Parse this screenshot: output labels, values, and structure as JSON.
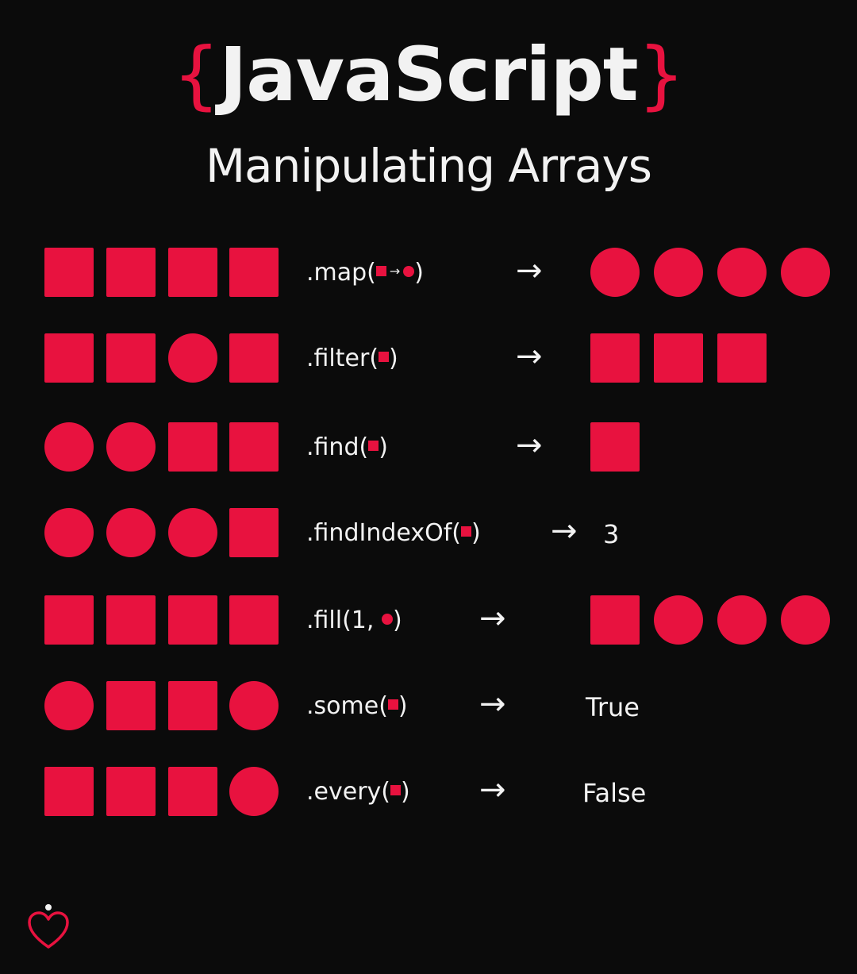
{
  "title": {
    "open_brace": "{",
    "text": "JavaScript",
    "close_brace": "}"
  },
  "subtitle": "Manipulating Arrays",
  "colors": {
    "accent": "#e8123f",
    "background": "#0b0b0b",
    "text": "#f2f2f2"
  },
  "arrow_glyph": "→",
  "rows": [
    {
      "input": [
        "square",
        "square",
        "square",
        "square"
      ],
      "method_parts": [
        ".map(",
        {
          "shape": "square"
        },
        {
          "arrow": "→"
        },
        {
          "shape": "circle"
        },
        ")"
      ],
      "result_shapes": [
        "circle",
        "circle",
        "circle",
        "circle"
      ]
    },
    {
      "input": [
        "square",
        "square",
        "circle",
        "square"
      ],
      "method_parts": [
        ".filter(",
        {
          "shape": "square"
        },
        ")"
      ],
      "result_shapes": [
        "square",
        "square",
        "square"
      ]
    },
    {
      "input": [
        "circle",
        "circle",
        "square",
        "square"
      ],
      "method_parts": [
        ".find(",
        {
          "shape": "square"
        },
        ")"
      ],
      "result_shapes": [
        "square"
      ]
    },
    {
      "input": [
        "circle",
        "circle",
        "circle",
        "square"
      ],
      "method_parts": [
        ".findIndexOf(",
        {
          "shape": "square"
        },
        ")"
      ],
      "result_text": "3"
    },
    {
      "input": [
        "square",
        "square",
        "square",
        "square"
      ],
      "method_parts": [
        ".fill(1, ",
        {
          "shape": "circle"
        },
        ")"
      ],
      "result_shapes": [
        "square",
        "circle",
        "circle",
        "circle"
      ]
    },
    {
      "input": [
        "circle",
        "square",
        "square",
        "circle"
      ],
      "method_parts": [
        ".some(",
        {
          "shape": "square"
        },
        ")"
      ],
      "result_text": "True"
    },
    {
      "input": [
        "square",
        "square",
        "square",
        "circle"
      ],
      "method_parts": [
        ".every(",
        {
          "shape": "square"
        },
        ")"
      ],
      "result_text": "False"
    }
  ],
  "footer": {
    "icon": "heart-icon"
  }
}
